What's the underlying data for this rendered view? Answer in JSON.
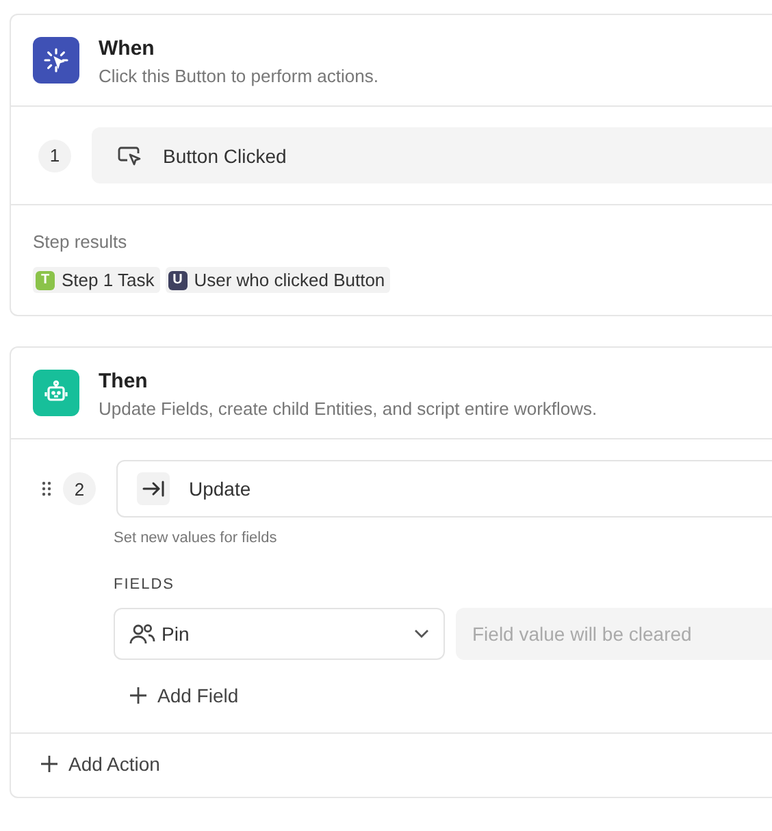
{
  "trigger": {
    "title": "When",
    "description": "Click this Button to perform actions.",
    "step": {
      "number": "1",
      "label": "Button Clicked"
    },
    "results_label": "Step results",
    "results": [
      {
        "badge": "T",
        "label": "Step 1 Task",
        "color": "#8bc34a"
      },
      {
        "badge": "U",
        "label": "User who clicked Button",
        "color": "#3f4160"
      }
    ]
  },
  "actions": {
    "title": "Then",
    "description": "Update Fields, create child Entities, and script entire workflows.",
    "step": {
      "number": "2",
      "label": "Update",
      "hint": "Set new values for fields",
      "fields_label": "FIELDS",
      "fields": [
        {
          "name": "Pin",
          "placeholder": "Field value will be cleared"
        }
      ],
      "add_field": "Add Field"
    },
    "add_action": "Add Action"
  }
}
